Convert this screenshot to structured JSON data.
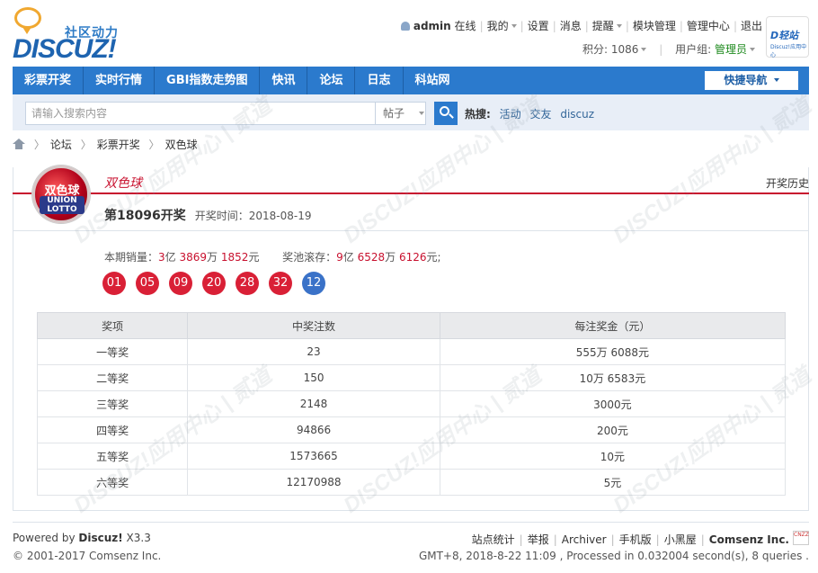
{
  "header": {
    "logo_cn": "社区动力",
    "logo_en": "DISCUZ!",
    "user": {
      "name": "admin",
      "status": "在线",
      "links": [
        "我的",
        "设置",
        "消息",
        "提醒",
        "模块管理",
        "管理中心",
        "退出"
      ]
    },
    "points": "积分: 1086",
    "group_label": "用户组: ",
    "group": "管理员",
    "badge_title": "D轻站",
    "badge_sub": "Discuz!应用中心"
  },
  "nav": {
    "items": [
      "彩票开奖",
      "实时行情",
      "GBI指数走势图",
      "快讯",
      "论坛",
      "日志",
      "科站网"
    ],
    "quick": "快捷导航"
  },
  "search": {
    "placeholder": "请输入搜索内容",
    "type": "帖子",
    "hot_label": "热搜:",
    "hot": [
      "活动",
      "交友",
      "discuz"
    ]
  },
  "breadcrumb": [
    "论坛",
    "彩票开奖",
    "双色球"
  ],
  "lottery": {
    "logo_l1": "双色球",
    "logo_l2": "UNION LOTTO",
    "name": "双色球",
    "history": "开奖历史",
    "issue": "第18096开奖",
    "date": "开奖时间：2018-08-19",
    "sales_label": "本期销量：",
    "sales_a": "3",
    "sales_a_unit": "亿",
    "sales_b": "3869",
    "sales_b_unit": "万",
    "sales_c": "1852",
    "sales_c_unit": "元",
    "pool_label": "奖池滚存：",
    "pool_a": "9",
    "pool_a_unit": "亿",
    "pool_b": "6528",
    "pool_b_unit": "万",
    "pool_c": "6126",
    "pool_c_unit": "元;",
    "red_balls": [
      "01",
      "05",
      "09",
      "20",
      "28",
      "32"
    ],
    "blue_ball": "12",
    "table": {
      "headers": [
        "奖项",
        "中奖注数",
        "每注奖金（元）"
      ],
      "rows": [
        [
          "一等奖",
          "23",
          "555万 6088元"
        ],
        [
          "二等奖",
          "150",
          "10万 6583元"
        ],
        [
          "三等奖",
          "2148",
          "3000元"
        ],
        [
          "四等奖",
          "94866",
          "200元"
        ],
        [
          "五等奖",
          "1573665",
          "10元"
        ],
        [
          "六等奖",
          "12170988",
          "5元"
        ]
      ]
    }
  },
  "footer": {
    "powered": "Powered by ",
    "brand": "Discuz!",
    "version": " X3.3",
    "copyright": "© 2001-2017 Comsenz Inc.",
    "links": [
      "站点统计",
      "举报",
      "Archiver",
      "手机版",
      "小黑屋"
    ],
    "company": "Comsenz Inc.",
    "cnzz": "CNZZ",
    "stats": "GMT+8, 2018-8-22 11:09 , Processed in 0.032004 second(s), 8 queries ."
  },
  "watermark": "DISCUZ!应用中心 | 贰道"
}
